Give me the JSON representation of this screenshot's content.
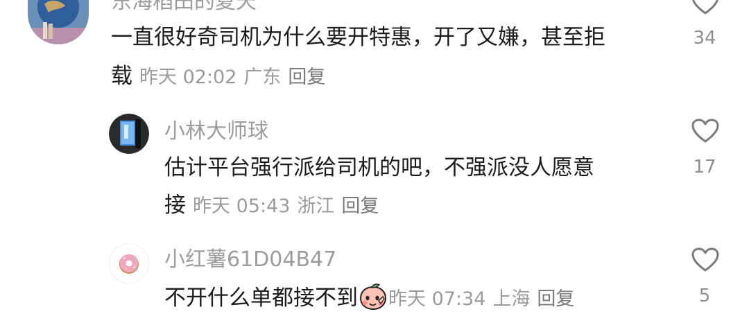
{
  "comments": [
    {
      "username": "东海稻田的夏天",
      "text_line1": "一直很好奇司机为什么要开特惠，开了又嫌，甚至拒",
      "text_line2": "载",
      "time": "昨天 02:02",
      "location": "广东",
      "reply_label": "回复",
      "likes": "34"
    },
    {
      "username": "小林大师球",
      "text_line1": "估计平台强行派给司机的吧，不强派没人愿意",
      "text_line2": "接",
      "time": "昨天 05:43",
      "location": "浙江",
      "reply_label": "回复",
      "likes": "17"
    },
    {
      "username": "小红薯61D04B47",
      "text_line1": "不开什么单都接不到",
      "time": "昨天 07:34",
      "location": "上海",
      "reply_label": "回复",
      "likes": "5",
      "emoji_icon": "peach-face-emoji"
    }
  ],
  "colors": {
    "username": "#9c9c9c",
    "text": "#1c1c1c",
    "meta": "#9a9a9a",
    "icon": "#7a7a7a"
  }
}
